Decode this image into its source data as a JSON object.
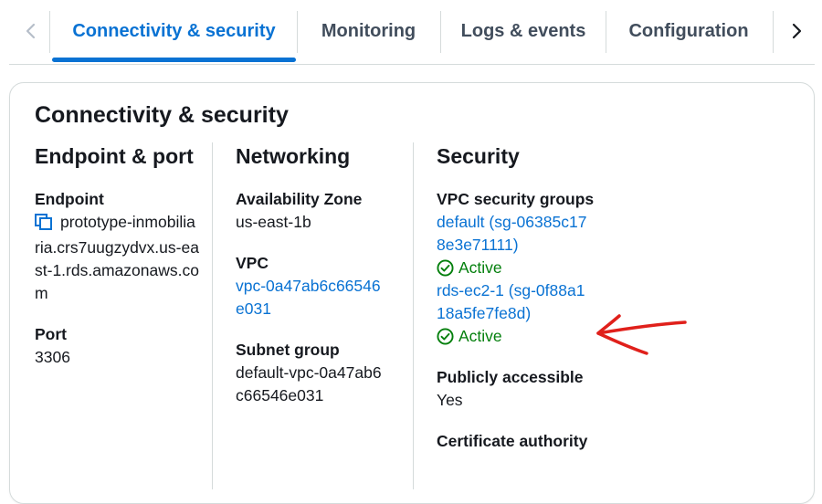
{
  "tabs": [
    {
      "label": "Connectivity & security",
      "active": true
    },
    {
      "label": "Monitoring",
      "active": false
    },
    {
      "label": "Logs & events",
      "active": false
    },
    {
      "label": "Configuration",
      "active": false
    }
  ],
  "panel": {
    "title": "Connectivity & security",
    "endpoint_port": {
      "heading": "Endpoint & port",
      "endpoint_label": "Endpoint",
      "endpoint_value": "prototype-inmobiliaria.crs7uugzydvx.us-east-1.rds.amazonaws.com",
      "port_label": "Port",
      "port_value": "3306"
    },
    "networking": {
      "heading": "Networking",
      "az_label": "Availability Zone",
      "az_value": "us-east-1b",
      "vpc_label": "VPC",
      "vpc_value": "vpc-0a47ab6c66546e031",
      "subnet_label": "Subnet group",
      "subnet_value": "default-vpc-0a47ab6c66546e031"
    },
    "security": {
      "heading": "Security",
      "sg_label": "VPC security groups",
      "groups": [
        {
          "name": "default (sg-06385c178e3e71111)",
          "status": "Active"
        },
        {
          "name": "rds-ec2-1 (sg-0f88a118a5fe7fe8d)",
          "status": "Active"
        }
      ],
      "public_label": "Publicly accessible",
      "public_value": "Yes",
      "ca_label": "Certificate authority"
    }
  },
  "colors": {
    "link": "#0972d3",
    "active_status": "#037f0c",
    "annotation": "#e0201b"
  },
  "icons": {
    "copy": "copy-icon",
    "status": "check-circle-icon",
    "scroll_left": "chevron-left-icon",
    "scroll_right": "chevron-right-icon"
  }
}
